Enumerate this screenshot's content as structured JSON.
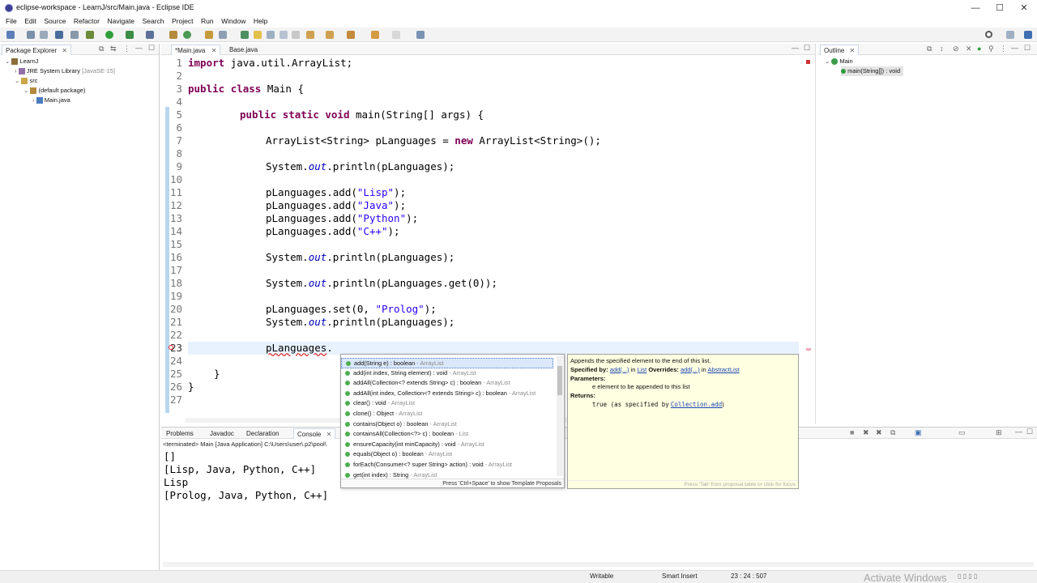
{
  "window": {
    "title": "eclipse-workspace - LearnJ/src/Main.java - Eclipse IDE",
    "min": "—",
    "max": "☐",
    "close": "✕"
  },
  "menu": [
    "File",
    "Edit",
    "Source",
    "Refactor",
    "Navigate",
    "Search",
    "Project",
    "Run",
    "Window",
    "Help"
  ],
  "package_explorer": {
    "tab": "Package Explorer",
    "tree": [
      {
        "label": "LearnJ",
        "level": 0,
        "icon": "project-icon"
      },
      {
        "label": "JRE System Library",
        "extra": "[JavaSE-15]",
        "level": 1,
        "icon": "library-icon"
      },
      {
        "label": "src",
        "level": 1,
        "icon": "source-folder-icon"
      },
      {
        "label": "(default package)",
        "level": 2,
        "icon": "package-icon"
      },
      {
        "label": "Main.java",
        "level": 3,
        "icon": "java-file-icon"
      }
    ]
  },
  "editor": {
    "tabs": [
      {
        "label": "*Main.java",
        "active": true
      },
      {
        "label": "Base.java",
        "active": false
      }
    ],
    "lines": [
      "1",
      "2",
      "3",
      "4",
      "5",
      "6",
      "7",
      "8",
      "9",
      "10",
      "11",
      "12",
      "13",
      "14",
      "15",
      "16",
      "17",
      "18",
      "19",
      "20",
      "21",
      "22",
      "23",
      "24",
      "25",
      "26",
      "27"
    ]
  },
  "outline": {
    "tab": "Outline",
    "class": "Main",
    "method": "main(String[]) : void"
  },
  "bottom": {
    "tabs": [
      "Problems",
      "Javadoc",
      "Declaration",
      "Console"
    ],
    "terminated": "<terminated> Main [Java Application] C:\\Users\\user\\.p2\\pool\\",
    "output": [
      "[]",
      "[Lisp, Java, Python, C++]",
      "Lisp",
      "[Prolog, Java, Python, C++]"
    ]
  },
  "proposals": {
    "items": [
      {
        "sig": "add(String e) : boolean",
        "own": "ArrayList"
      },
      {
        "sig": "add(int index, String element) : void",
        "own": "ArrayList"
      },
      {
        "sig": "addAll(Collection<? extends String> c) : boolean",
        "own": "ArrayList"
      },
      {
        "sig": "addAll(int index, Collection<? extends String> c) : boolean",
        "own": "ArrayList"
      },
      {
        "sig": "clear() : void",
        "own": "ArrayList"
      },
      {
        "sig": "clone() : Object",
        "own": "ArrayList"
      },
      {
        "sig": "contains(Object o) : boolean",
        "own": "ArrayList"
      },
      {
        "sig": "containsAll(Collection<?> c) : boolean",
        "own": "List"
      },
      {
        "sig": "ensureCapacity(int minCapacity) : void",
        "own": "ArrayList"
      },
      {
        "sig": "equals(Object o) : boolean",
        "own": "ArrayList"
      },
      {
        "sig": "forEach(Consumer<? super String> action) : void",
        "own": "ArrayList"
      },
      {
        "sig": "get(int index) : String",
        "own": "ArrayList"
      }
    ],
    "hint": "Press 'Ctrl+Space' to show Template Proposals"
  },
  "javadoc": {
    "summary": "Appends the specified element to the end of this list.",
    "specified_label": "Specified by:",
    "specified_link": "add(...)",
    "in1": "in",
    "list_link": "List",
    "overrides_label": "Overrides:",
    "overrides_link": "add(...)",
    "in2": "in",
    "abstract_link": "AbstractList",
    "params_label": "Parameters:",
    "param": "e element to be appended to this list",
    "returns_label": "Returns:",
    "returns_val": "true (as specified by",
    "returns_link": "Collection.add",
    "returns_end": ")",
    "footer": "Press 'Tab' from proposal table or click for focus"
  },
  "status": {
    "writable": "Writable",
    "insert": "Smart Insert",
    "pos": "23 : 24 : 507"
  },
  "watermark": "Activate Windows",
  "colors": {
    "keyword": "#7f0055",
    "string": "#2a00ff",
    "field": "#0000c0",
    "selection": "#dbe8fa"
  }
}
